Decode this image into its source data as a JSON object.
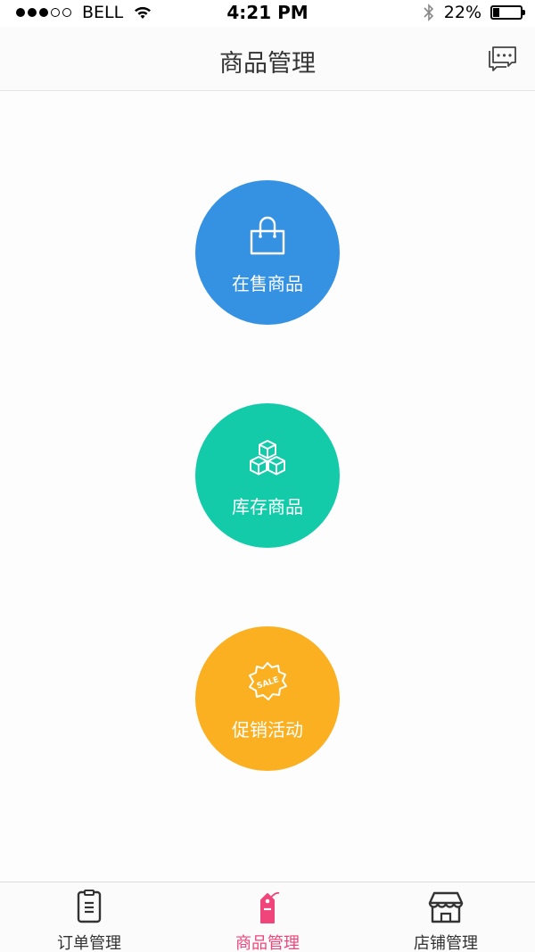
{
  "status_bar": {
    "carrier": "BELL",
    "time": "4:21 PM",
    "battery_percent": "22%",
    "battery_level": 0.22,
    "signal_bars_full": 3,
    "signal_bars_total": 5
  },
  "nav": {
    "title": "商品管理",
    "message_icon": "chat-bubble-icon"
  },
  "menu": [
    {
      "label": "在售商品",
      "icon": "shopping-bag-icon",
      "color": "#3592e2"
    },
    {
      "label": "库存商品",
      "icon": "boxes-icon",
      "color": "#13cba9"
    },
    {
      "label": "促销活动",
      "icon": "sale-badge-icon",
      "color": "#fbb022",
      "icon_text": "SALE"
    }
  ],
  "tabs": [
    {
      "label": "订单管理",
      "icon": "clipboard-icon",
      "active": false
    },
    {
      "label": "商品管理",
      "icon": "price-tag-icon",
      "active": true
    },
    {
      "label": "店铺管理",
      "icon": "storefront-icon",
      "active": false
    }
  ],
  "colors": {
    "accent": "#f0457a",
    "text": "#333333"
  }
}
